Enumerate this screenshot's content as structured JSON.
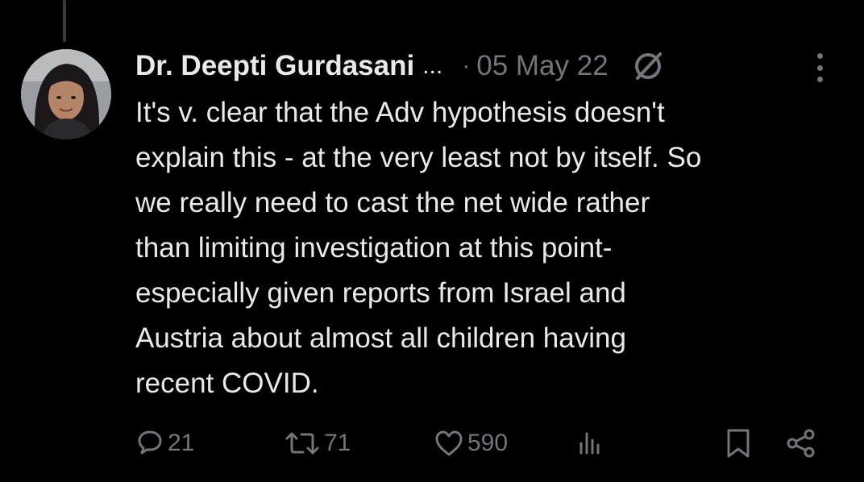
{
  "author": {
    "display_name": "Dr. Deepti Gurdasani",
    "truncation": "..."
  },
  "meta": {
    "separator": "·",
    "timestamp": "05 May 22"
  },
  "tweet": {
    "lines": [
      "It's v. clear that the Adv hypothesis doesn't",
      "explain this - at the very least not by itself. So",
      "we really need to cast the net wide rather",
      "than limiting investigation at this point-",
      "especially given reports from Israel and",
      "Austria about almost all children having",
      "recent COVID."
    ]
  },
  "actions": {
    "replies": "21",
    "retweets": "71",
    "likes": "590"
  },
  "icons": {
    "edited": "edited-slash-icon",
    "more": "more-vertical-icon",
    "reply": "reply-bubble-icon",
    "retweet": "retweet-icon",
    "like": "heart-icon",
    "views": "views-bar-chart-icon",
    "bookmark": "bookmark-icon",
    "share": "share-icon"
  },
  "colors": {
    "background": "#000000",
    "text": "#e7e9ea",
    "muted": "#71767b"
  }
}
